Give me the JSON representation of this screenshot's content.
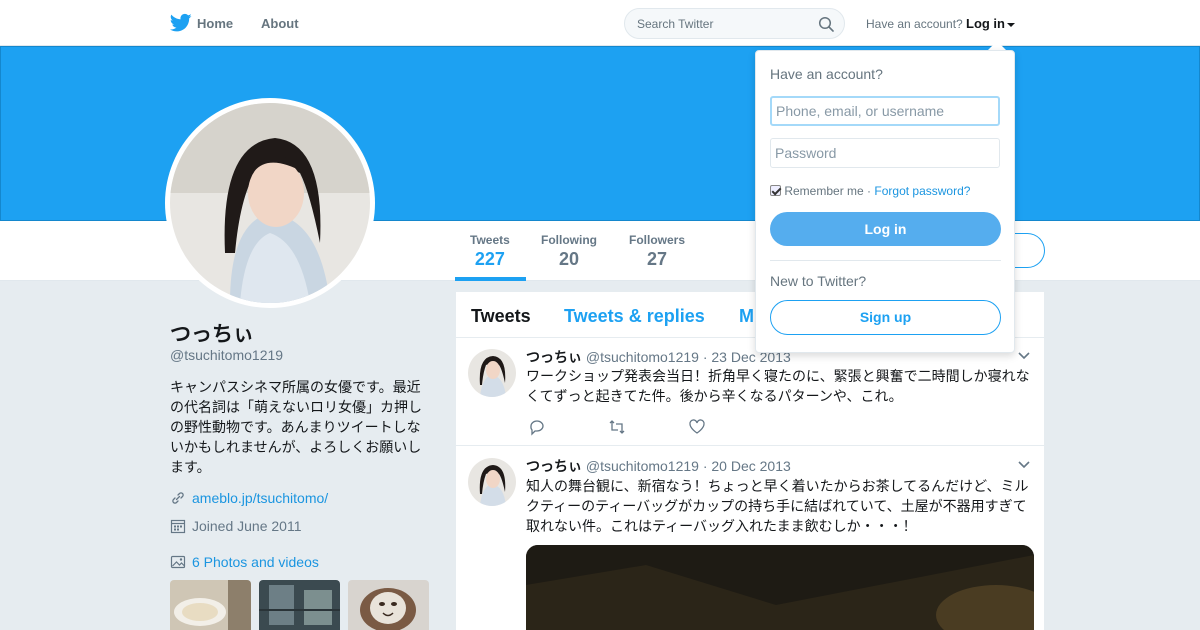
{
  "nav": {
    "home_label": "Home",
    "about_label": "About",
    "search_placeholder": "Search Twitter",
    "have_account_text": "Have an account?",
    "login_label": "Log in",
    "logo_icon": "twitter-bird-icon",
    "search_icon": "search-icon"
  },
  "colors": {
    "brand": "#1da1f2",
    "link": "#1b95e0",
    "login_button": "#55adee"
  },
  "profile": {
    "name": "つっちぃ",
    "handle": "@tsuchitomo1219",
    "bio": "キャンパスシネマ所属の女優です。最近の代名詞は「萌えないロリ女優」カ押しの野性動物です。あんまりツイートしないかもしれませんが、よろしくお願いします。",
    "url": "ameblo.jp/tsuchitomo/",
    "joined": "Joined June 2011",
    "photos_label": "6 Photos and videos"
  },
  "stats": [
    {
      "label": "Tweets",
      "value": "227"
    },
    {
      "label": "Following",
      "value": "20"
    },
    {
      "label": "Followers",
      "value": "27"
    }
  ],
  "timeline": {
    "tabs": [
      "Tweets",
      "Tweets & replies",
      "M"
    ],
    "tweets": [
      {
        "name": "つっちぃ",
        "meta": "@tsuchitomo1219 · 23 Dec 2013",
        "text": "ワークショップ発表会当日！折角早く寝たのに、緊張と興奮で二時間しか寝れなくてずっと起きてた件。後から辛くなるパターンや、これ。"
      },
      {
        "name": "つっちぃ",
        "meta": "@tsuchitomo1219 · 20 Dec 2013",
        "text": "知人の舞台観に、新宿なう！ちょっと早く着いたからお茶してるんだけど、ミルクティーのティーバッグがカップの持ち手に結ばれていて、土屋が不器用すぎて取れない件。これはティーバッグ入れたまま飲むしか・・・！"
      }
    ]
  },
  "login_dropdown": {
    "title": "Have an account?",
    "username_placeholder": "Phone, email, or username",
    "password_placeholder": "Password",
    "remember_label": "Remember me",
    "separator": "·",
    "forgot_label": "Forgot password?",
    "login_button": "Log in",
    "new_label": "New to Twitter?",
    "signup_button": "Sign up"
  }
}
